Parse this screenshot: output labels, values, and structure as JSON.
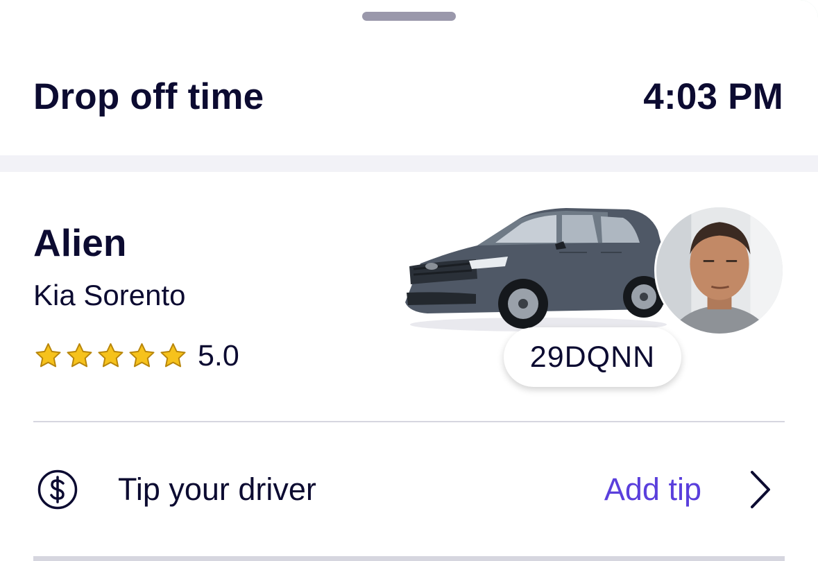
{
  "dropoff": {
    "label": "Drop off time",
    "time": "4:03 PM"
  },
  "driver": {
    "name": "Alien",
    "vehicle_model": "Kia Sorento",
    "rating": "5.0",
    "star_count": 5,
    "license_plate": "29DQNN"
  },
  "tip": {
    "label": "Tip your driver",
    "action_label": "Add tip",
    "icon": "dollar-circle-icon"
  },
  "colors": {
    "text_primary": "#0c0b31",
    "accent": "#5a3fdc",
    "star_fill": "#f6c21c",
    "divider": "#d6d6df"
  }
}
